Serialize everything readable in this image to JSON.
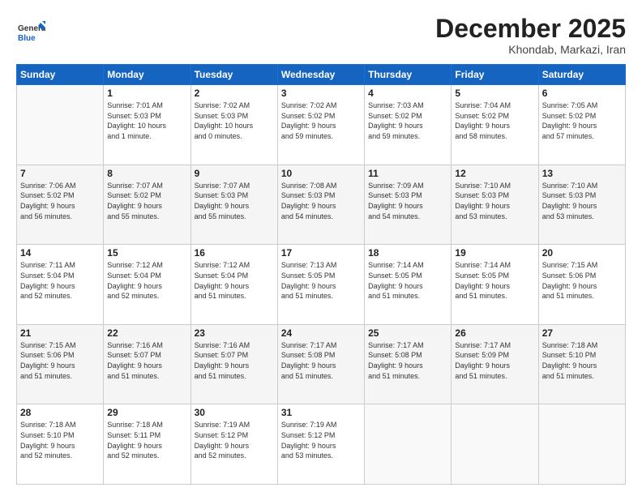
{
  "header": {
    "logo_general": "General",
    "logo_blue": "Blue",
    "main_title": "December 2025",
    "sub_title": "Khondab, Markazi, Iran"
  },
  "days_of_week": [
    "Sunday",
    "Monday",
    "Tuesday",
    "Wednesday",
    "Thursday",
    "Friday",
    "Saturday"
  ],
  "weeks": [
    [
      {
        "day": "",
        "info": ""
      },
      {
        "day": "1",
        "info": "Sunrise: 7:01 AM\nSunset: 5:03 PM\nDaylight: 10 hours\nand 1 minute."
      },
      {
        "day": "2",
        "info": "Sunrise: 7:02 AM\nSunset: 5:03 PM\nDaylight: 10 hours\nand 0 minutes."
      },
      {
        "day": "3",
        "info": "Sunrise: 7:02 AM\nSunset: 5:02 PM\nDaylight: 9 hours\nand 59 minutes."
      },
      {
        "day": "4",
        "info": "Sunrise: 7:03 AM\nSunset: 5:02 PM\nDaylight: 9 hours\nand 59 minutes."
      },
      {
        "day": "5",
        "info": "Sunrise: 7:04 AM\nSunset: 5:02 PM\nDaylight: 9 hours\nand 58 minutes."
      },
      {
        "day": "6",
        "info": "Sunrise: 7:05 AM\nSunset: 5:02 PM\nDaylight: 9 hours\nand 57 minutes."
      }
    ],
    [
      {
        "day": "7",
        "info": "Sunrise: 7:06 AM\nSunset: 5:02 PM\nDaylight: 9 hours\nand 56 minutes."
      },
      {
        "day": "8",
        "info": "Sunrise: 7:07 AM\nSunset: 5:02 PM\nDaylight: 9 hours\nand 55 minutes."
      },
      {
        "day": "9",
        "info": "Sunrise: 7:07 AM\nSunset: 5:03 PM\nDaylight: 9 hours\nand 55 minutes."
      },
      {
        "day": "10",
        "info": "Sunrise: 7:08 AM\nSunset: 5:03 PM\nDaylight: 9 hours\nand 54 minutes."
      },
      {
        "day": "11",
        "info": "Sunrise: 7:09 AM\nSunset: 5:03 PM\nDaylight: 9 hours\nand 54 minutes."
      },
      {
        "day": "12",
        "info": "Sunrise: 7:10 AM\nSunset: 5:03 PM\nDaylight: 9 hours\nand 53 minutes."
      },
      {
        "day": "13",
        "info": "Sunrise: 7:10 AM\nSunset: 5:03 PM\nDaylight: 9 hours\nand 53 minutes."
      }
    ],
    [
      {
        "day": "14",
        "info": "Sunrise: 7:11 AM\nSunset: 5:04 PM\nDaylight: 9 hours\nand 52 minutes."
      },
      {
        "day": "15",
        "info": "Sunrise: 7:12 AM\nSunset: 5:04 PM\nDaylight: 9 hours\nand 52 minutes."
      },
      {
        "day": "16",
        "info": "Sunrise: 7:12 AM\nSunset: 5:04 PM\nDaylight: 9 hours\nand 51 minutes."
      },
      {
        "day": "17",
        "info": "Sunrise: 7:13 AM\nSunset: 5:05 PM\nDaylight: 9 hours\nand 51 minutes."
      },
      {
        "day": "18",
        "info": "Sunrise: 7:14 AM\nSunset: 5:05 PM\nDaylight: 9 hours\nand 51 minutes."
      },
      {
        "day": "19",
        "info": "Sunrise: 7:14 AM\nSunset: 5:05 PM\nDaylight: 9 hours\nand 51 minutes."
      },
      {
        "day": "20",
        "info": "Sunrise: 7:15 AM\nSunset: 5:06 PM\nDaylight: 9 hours\nand 51 minutes."
      }
    ],
    [
      {
        "day": "21",
        "info": "Sunrise: 7:15 AM\nSunset: 5:06 PM\nDaylight: 9 hours\nand 51 minutes."
      },
      {
        "day": "22",
        "info": "Sunrise: 7:16 AM\nSunset: 5:07 PM\nDaylight: 9 hours\nand 51 minutes."
      },
      {
        "day": "23",
        "info": "Sunrise: 7:16 AM\nSunset: 5:07 PM\nDaylight: 9 hours\nand 51 minutes."
      },
      {
        "day": "24",
        "info": "Sunrise: 7:17 AM\nSunset: 5:08 PM\nDaylight: 9 hours\nand 51 minutes."
      },
      {
        "day": "25",
        "info": "Sunrise: 7:17 AM\nSunset: 5:08 PM\nDaylight: 9 hours\nand 51 minutes."
      },
      {
        "day": "26",
        "info": "Sunrise: 7:17 AM\nSunset: 5:09 PM\nDaylight: 9 hours\nand 51 minutes."
      },
      {
        "day": "27",
        "info": "Sunrise: 7:18 AM\nSunset: 5:10 PM\nDaylight: 9 hours\nand 51 minutes."
      }
    ],
    [
      {
        "day": "28",
        "info": "Sunrise: 7:18 AM\nSunset: 5:10 PM\nDaylight: 9 hours\nand 52 minutes."
      },
      {
        "day": "29",
        "info": "Sunrise: 7:18 AM\nSunset: 5:11 PM\nDaylight: 9 hours\nand 52 minutes."
      },
      {
        "day": "30",
        "info": "Sunrise: 7:19 AM\nSunset: 5:12 PM\nDaylight: 9 hours\nand 52 minutes."
      },
      {
        "day": "31",
        "info": "Sunrise: 7:19 AM\nSunset: 5:12 PM\nDaylight: 9 hours\nand 53 minutes."
      },
      {
        "day": "",
        "info": ""
      },
      {
        "day": "",
        "info": ""
      },
      {
        "day": "",
        "info": ""
      }
    ]
  ]
}
